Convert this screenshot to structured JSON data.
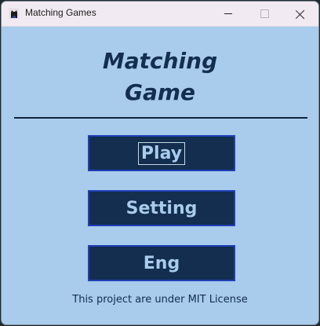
{
  "window": {
    "title": "Matching Games",
    "icon": "cat-icon",
    "controls": [
      "minimize",
      "maximize",
      "close"
    ]
  },
  "main": {
    "heading_line1": "Matching",
    "heading_line2": "Game",
    "buttons": {
      "play": "Play",
      "setting": "Setting",
      "language": "Eng"
    },
    "license": "This project are under MIT License"
  },
  "colors": {
    "background": "#a9cbec",
    "button_bg": "#132e4e",
    "button_border": "#1f3fb8",
    "heading": "#132e4e"
  }
}
